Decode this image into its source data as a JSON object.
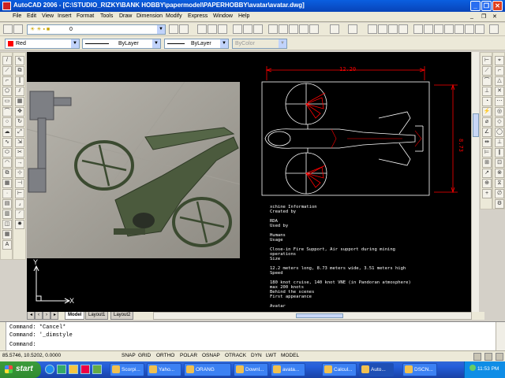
{
  "window": {
    "title": "AutoCAD 2006 - [C:\\STUDIO_RIZKY\\BANK HOBBY\\papermodel\\PAPERHOBBY\\avatar\\avatar.dwg]",
    "minimize": "_",
    "restore": "❐",
    "close": "✕"
  },
  "menu": {
    "items": [
      "File",
      "Edit",
      "View",
      "Insert",
      "Format",
      "Tools",
      "Draw",
      "Dimension",
      "Modify",
      "Express",
      "Window",
      "Help"
    ],
    "doc_controls": [
      "_",
      "❐",
      "✕"
    ]
  },
  "toolbar": {
    "layer_value": "0",
    "color_value": "Red",
    "linetype_value": "ByLayer",
    "lineweight_value": "ByLayer",
    "plotstyle_value": "ByColor"
  },
  "drawing": {
    "dimension_width": "12.20",
    "dimension_height": "8.73",
    "ucs_x": "X",
    "ucs_y": "Y",
    "notes": [
      "xchine Information",
      "Created by",
      "",
      "RDA",
      "Used by",
      "",
      "Humans",
      "Usage",
      "",
      "Close-in Fire Support, Air support during mining",
      "operations",
      "Size",
      "",
      "12.2 meters long, 8.73 meters wide, 3.51 meters high",
      "Speed",
      "",
      "180 knot cruise, 140 knot VNE (in Pandoran atmosphere)",
      "max 200 knots",
      "Behind the scenes",
      "First appearance",
      "",
      "Avatar"
    ]
  },
  "tabs": [
    "Model",
    "Layout1",
    "Layout2"
  ],
  "command": {
    "lines": [
      "Command:  *Cancel*",
      "Command:  '_dimstyle",
      "Command:"
    ]
  },
  "status": {
    "coords": "85.5746, 10.5202, 0.0000",
    "toggles": [
      "SNAP",
      "GRID",
      "ORTHO",
      "POLAR",
      "OSNAP",
      "OTRACK",
      "DYN",
      "LWT",
      "MODEL"
    ]
  },
  "taskbar": {
    "start_label": "start",
    "buttons": [
      "Scorpi...",
      "Yaho...",
      "ORANG",
      "Downl...",
      "avata...",
      "Calcul...",
      "Auto...",
      "DSCN..."
    ],
    "clock": "11:53 PM"
  },
  "colors": {
    "drawing_bg": "#000000",
    "dimension": "#ff0000",
    "model_lines": "#ffffff",
    "title_bar": "#0a5fe0"
  }
}
